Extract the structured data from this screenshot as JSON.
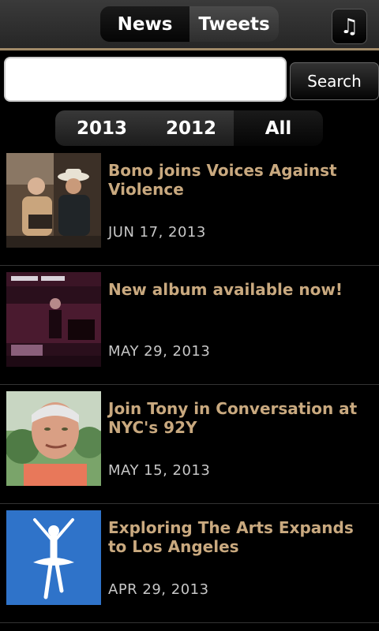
{
  "header": {
    "tabs": [
      {
        "label": "News"
      },
      {
        "label": "Tweets"
      }
    ],
    "music_icon": "music-note-icon",
    "music_glyph": "♫"
  },
  "search": {
    "value": "",
    "placeholder": "",
    "button_label": "Search"
  },
  "year_filter": {
    "options": [
      {
        "label": "2013"
      },
      {
        "label": "2012"
      },
      {
        "label": "All"
      }
    ],
    "selected": "All"
  },
  "news": [
    {
      "title": "Bono joins Voices Against Violence",
      "date": "JUN 17, 2013"
    },
    {
      "title": "New album available now!",
      "date": "MAY 29, 2013"
    },
    {
      "title": "Join Tony in Conversation at NYC's 92Y",
      "date": "MAY 15, 2013"
    },
    {
      "title": "Exploring The Arts Expands to Los Angeles",
      "date": "APR 29, 2013"
    }
  ],
  "colors": {
    "accent": "#a08a68",
    "title": "#c9a97f",
    "date": "#c7c7c7",
    "background": "#000000"
  }
}
